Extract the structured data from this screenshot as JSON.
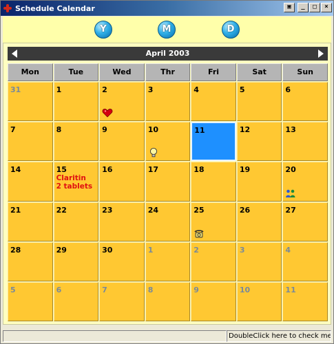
{
  "window": {
    "title": "Schedule Calendar"
  },
  "toolbar": {
    "year_label": "Y",
    "month_label": "M",
    "day_label": "D"
  },
  "calendar": {
    "month_label": "April 2003",
    "weekdays": [
      "Mon",
      "Tue",
      "Wed",
      "Thr",
      "Fri",
      "Sat",
      "Sun"
    ],
    "cells": [
      {
        "day": "31",
        "current_month": false
      },
      {
        "day": "1",
        "current_month": true
      },
      {
        "day": "2",
        "current_month": true,
        "icon": "heart-icon"
      },
      {
        "day": "3",
        "current_month": true
      },
      {
        "day": "4",
        "current_month": true
      },
      {
        "day": "5",
        "current_month": true
      },
      {
        "day": "6",
        "current_month": true
      },
      {
        "day": "7",
        "current_month": true
      },
      {
        "day": "8",
        "current_month": true
      },
      {
        "day": "9",
        "current_month": true
      },
      {
        "day": "10",
        "current_month": true,
        "icon": "lightbulb-icon"
      },
      {
        "day": "11",
        "current_month": true,
        "today": true
      },
      {
        "day": "12",
        "current_month": true
      },
      {
        "day": "13",
        "current_month": true
      },
      {
        "day": "14",
        "current_month": true
      },
      {
        "day": "15",
        "current_month": true,
        "note_line1": "Claritin",
        "note_line2": "2 tablets"
      },
      {
        "day": "16",
        "current_month": true
      },
      {
        "day": "17",
        "current_month": true
      },
      {
        "day": "18",
        "current_month": true
      },
      {
        "day": "19",
        "current_month": true
      },
      {
        "day": "20",
        "current_month": true,
        "icon": "people-icon"
      },
      {
        "day": "21",
        "current_month": true
      },
      {
        "day": "22",
        "current_month": true
      },
      {
        "day": "23",
        "current_month": true
      },
      {
        "day": "24",
        "current_month": true
      },
      {
        "day": "25",
        "current_month": true,
        "icon": "phone-icon"
      },
      {
        "day": "26",
        "current_month": true
      },
      {
        "day": "27",
        "current_month": true
      },
      {
        "day": "28",
        "current_month": true
      },
      {
        "day": "29",
        "current_month": true
      },
      {
        "day": "30",
        "current_month": true
      },
      {
        "day": "1",
        "current_month": false
      },
      {
        "day": "2",
        "current_month": false
      },
      {
        "day": "3",
        "current_month": false
      },
      {
        "day": "4",
        "current_month": false
      },
      {
        "day": "5",
        "current_month": false
      },
      {
        "day": "6",
        "current_month": false
      },
      {
        "day": "7",
        "current_month": false
      },
      {
        "day": "8",
        "current_month": false
      },
      {
        "day": "9",
        "current_month": false
      },
      {
        "day": "10",
        "current_month": false
      },
      {
        "day": "11",
        "current_month": false
      }
    ]
  },
  "statusbar": {
    "hint": "DoubleClick here to check mes"
  },
  "colors": {
    "cell": "#ffc832",
    "today": "#1e90ff",
    "note": "#e01010",
    "month_bar": "#3a3a3a"
  }
}
